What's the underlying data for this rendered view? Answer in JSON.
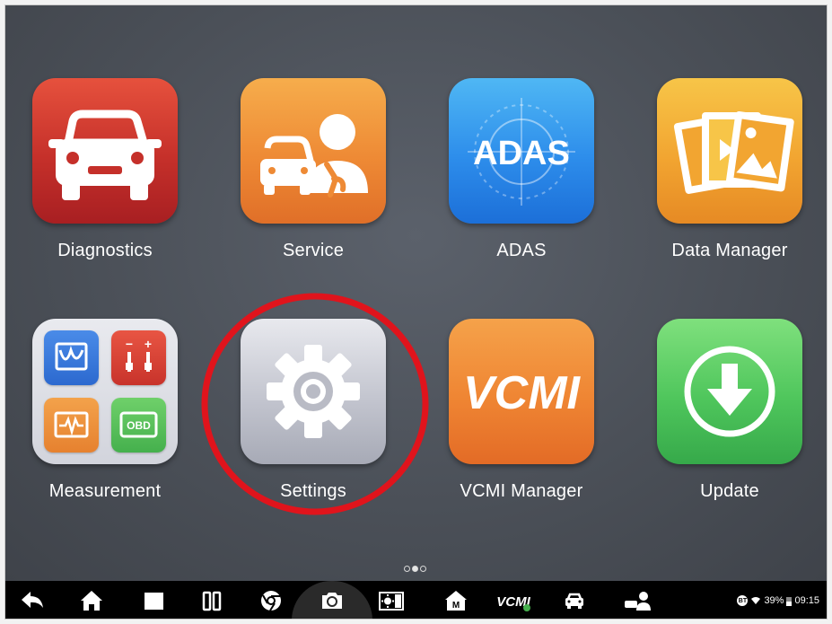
{
  "apps": [
    {
      "label": "Diagnostics",
      "icon": "car-front-icon"
    },
    {
      "label": "Service",
      "icon": "service-technician-icon"
    },
    {
      "label": "ADAS",
      "icon": "adas-icon",
      "icon_text": "ADAS"
    },
    {
      "label": "Data Manager",
      "icon": "photo-files-icon"
    },
    {
      "label": "Measurement",
      "icon": "measurement-icon",
      "sub_icons": [
        "oscilloscope-icon",
        "multimeter-icon",
        "waveform-icon",
        "obd-icon"
      ],
      "obd_text": "OBD"
    },
    {
      "label": "Settings",
      "icon": "gear-icon"
    },
    {
      "label": "VCMI Manager",
      "icon": "vcmi-icon",
      "icon_text": "VCMI"
    },
    {
      "label": "Update",
      "icon": "download-arrow-icon"
    }
  ],
  "annotation": {
    "type": "red-circle",
    "target": "Settings",
    "color": "#e0141c"
  },
  "page_indicator": {
    "pages": 3,
    "current": 2
  },
  "navbar": {
    "buttons": [
      "back-icon",
      "home-icon",
      "recent-apps-icon",
      "split-screen-icon",
      "browser-icon",
      "camera-icon",
      "display-brightness-icon",
      "manufacturer-home-icon",
      "vcmi-shortcut-icon",
      "vehicle-icon",
      "technician-icon"
    ],
    "vcmi_text": "VCMI"
  },
  "status": {
    "bluetooth": "BT",
    "battery": "39%",
    "time": "09:15"
  }
}
